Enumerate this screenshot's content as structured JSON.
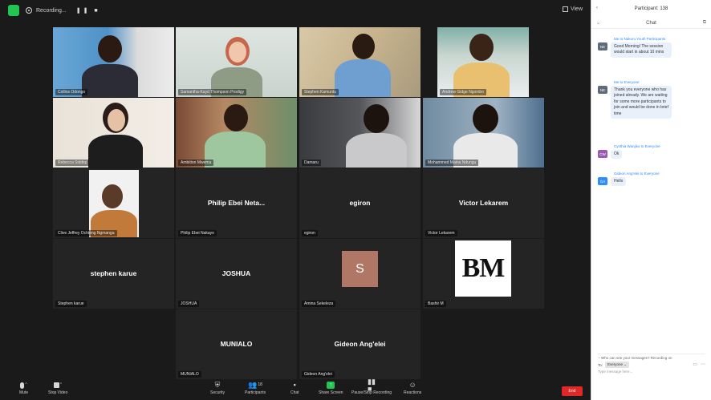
{
  "window": {
    "recording_label": "Recording...",
    "view_label": "View"
  },
  "gallery": {
    "tiles": [
      {
        "name": "Collins Odongo",
        "center": ""
      },
      {
        "name": "Samantha-Kayd Thompson Prodigy",
        "center": ""
      },
      {
        "name": "Stephen Kamuntu",
        "center": ""
      },
      {
        "name": "Andrew Gidge Ngombo",
        "center": ""
      },
      {
        "name": "Rebecca Siddiqi",
        "center": ""
      },
      {
        "name": "Ambition Mwema",
        "center": ""
      },
      {
        "name": "Damaru",
        "center": ""
      },
      {
        "name": "Mohammed Maina Ndungu",
        "center": ""
      },
      {
        "name": "Clive Jeffrey Ochieng Ngmanga",
        "center": ""
      },
      {
        "name": "Philip Ebei Nakayo",
        "center": "Philip Ebei Neta..."
      },
      {
        "name": "egiron",
        "center": "egiron"
      },
      {
        "name": "Victor Lekarem",
        "center": "Victor Lekarem"
      },
      {
        "name": "Stephen karue",
        "center": "stephen karue"
      },
      {
        "name": "JOSHUA",
        "center": "JOSHUA"
      },
      {
        "name": "Amina Sekeleza",
        "center": "",
        "avatar_letter": "S"
      },
      {
        "name": "Bashir M",
        "center": "",
        "logo_text": "BM"
      },
      {
        "name": "MUNIALO",
        "center": "MUNIALO"
      },
      {
        "name": "Gideon Ang'elei",
        "center": "Gideon Ang'elei"
      }
    ]
  },
  "toolbar": {
    "mute": "Mute",
    "stop_video": "Stop Video",
    "security": "Security",
    "participants": "Participants",
    "participants_count": "18",
    "chat": "Chat",
    "share_screen": "Share Screen",
    "pause_share": "Pause/Stop Recording",
    "reactions": "Reactions",
    "end": "End"
  },
  "chat": {
    "window_title": "Participant: 138",
    "title": "Chat",
    "messages": [
      {
        "from": "Me to Nakuru Youth Participants",
        "initials": "NE",
        "color": "#5f6b7a",
        "text": "Good Morning! The session would start in about 10 mins"
      },
      {
        "from": "Me to Everyone",
        "initials": "NE",
        "color": "#5f6b7a",
        "text": "Thank you everyone who has joined already. We are waiting for some more participants to join and would be done in brief time"
      },
      {
        "from": "Cynthia Wanjiku to Everyone",
        "initials": "CW",
        "color": "#9b59b6",
        "text": "Ok"
      },
      {
        "from": "Gideon Ang'elei to Everyone",
        "initials": "GA",
        "color": "#2d8cff",
        "text": "Hello"
      }
    ],
    "share_tip": "Who can see your messages? Recording on",
    "to_label": "To:",
    "to_value": "Everyone",
    "input_placeholder": "Type message here..."
  }
}
